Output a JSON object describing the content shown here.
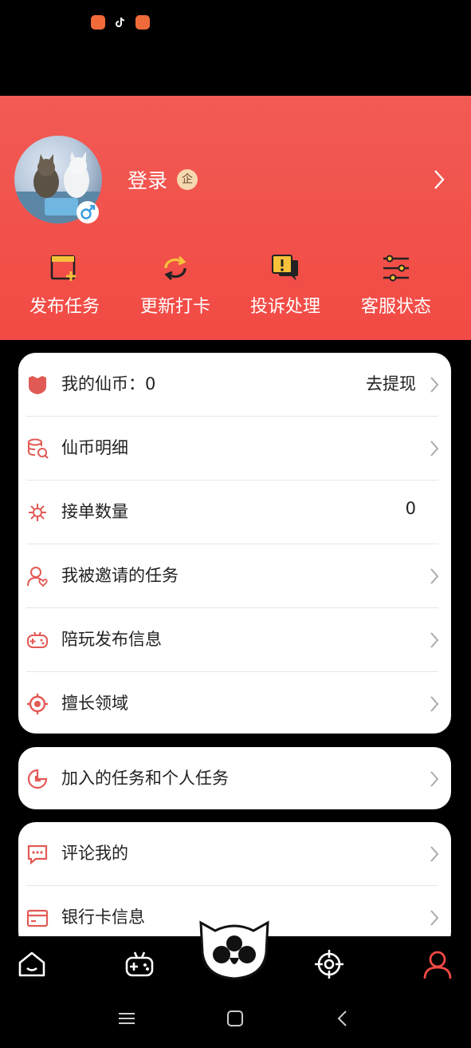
{
  "colors": {
    "accent": "#f24a44",
    "icon_red": "#e25a55",
    "bg": "#000000"
  },
  "profile": {
    "name": "登录",
    "badge": "企",
    "gender_icon": "male-icon"
  },
  "quick_actions": [
    {
      "label": "发布任务",
      "icon": "publish-task-icon"
    },
    {
      "label": "更新打卡",
      "icon": "refresh-checkin-icon"
    },
    {
      "label": "投诉处理",
      "icon": "complaint-icon"
    },
    {
      "label": "客服状态",
      "icon": "settings-sliders-icon"
    }
  ],
  "card1": {
    "coins": {
      "label": "我的仙币：0",
      "action": "去提现",
      "icon": "coin-shield-icon"
    },
    "coin_detail": {
      "label": "仙币明细",
      "icon": "coin-stack-icon"
    },
    "orders": {
      "label": "接单数量",
      "value": "0",
      "icon": "network-icon"
    },
    "invited": {
      "label": "我被邀请的任务",
      "icon": "user-heart-icon"
    },
    "companion": {
      "label": "陪玩发布信息",
      "icon": "gamepad-icon"
    },
    "expertise": {
      "label": "擅长领域",
      "icon": "target-icon"
    }
  },
  "card2": {
    "joined": {
      "label": "加入的任务和个人任务",
      "icon": "pie-chart-icon"
    }
  },
  "card3": {
    "comments": {
      "label": "评论我的",
      "icon": "comment-icon"
    },
    "bank": {
      "label": "银行卡信息",
      "icon": "bank-card-icon"
    }
  },
  "bottom_nav": [
    {
      "name": "home",
      "icon": "home-icon",
      "active": false
    },
    {
      "name": "game",
      "icon": "gamepad-icon",
      "active": false
    },
    {
      "name": "center",
      "icon": "cat-logo-icon",
      "active": false
    },
    {
      "name": "target",
      "icon": "crosshair-icon",
      "active": false
    },
    {
      "name": "profile",
      "icon": "user-icon",
      "active": true
    }
  ]
}
